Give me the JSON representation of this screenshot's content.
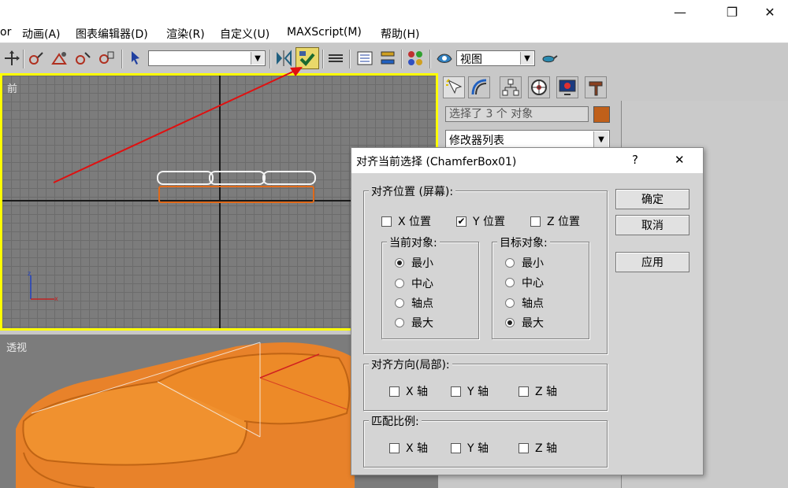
{
  "window": {
    "minimize_glyph": "—",
    "restore_glyph": "❐",
    "close_glyph": "✕"
  },
  "menu": {
    "items": [
      {
        "label": "or"
      },
      {
        "label": "动画(A)"
      },
      {
        "label": "图表编辑器(D)"
      },
      {
        "label": "渲染(R)"
      },
      {
        "label": "自定义(U)"
      },
      {
        "label": "MAXScript(M)"
      },
      {
        "label": "帮助(H)"
      }
    ]
  },
  "toolbar": {
    "selection_set_value": "",
    "view_combo_value": "视图",
    "icons": [
      "move-icon",
      "link-icon",
      "unlink-icon",
      "bind-icon",
      "select-icon",
      "mirror-icon",
      "align-icon",
      "layers-icon",
      "curve-editor-icon",
      "schematic-icon",
      "material-editor-icon",
      "render-setup-icon",
      "render-icon"
    ]
  },
  "viewports": {
    "front_label": "前",
    "persp_label": "透视",
    "active_border_color": "#ffff00",
    "object_color": "#e8822a"
  },
  "command_panel": {
    "tabs": [
      "create-icon",
      "modify-icon",
      "hierarchy-icon",
      "motion-icon",
      "display-icon",
      "utilities-icon"
    ],
    "selection_text": "选择了 3 个 对象",
    "swatch_color": "#c0601a",
    "modifier_list": "修改器列表"
  },
  "dialog": {
    "title": "对齐当前选择 (ChamferBox01)",
    "help_glyph": "?",
    "close_glyph": "✕",
    "align_position": {
      "title": "对齐位置 (屏幕):",
      "x": {
        "label": "X 位置",
        "checked": false
      },
      "y": {
        "label": "Y 位置",
        "checked": true
      },
      "z": {
        "label": "Z 位置",
        "checked": false
      }
    },
    "current_object": {
      "title": "当前对象:",
      "options": [
        "最小",
        "中心",
        "轴点",
        "最大"
      ],
      "selected": "最小"
    },
    "target_object": {
      "title": "目标对象:",
      "options": [
        "最小",
        "中心",
        "轴点",
        "最大"
      ],
      "selected": "最大"
    },
    "align_orientation": {
      "title": "对齐方向(局部):",
      "x": "X 轴",
      "y": "Y 轴",
      "z": "Z 轴"
    },
    "match_scale": {
      "title": "匹配比例:",
      "x": "X 轴",
      "y": "Y 轴",
      "z": "Z 轴"
    },
    "buttons": {
      "ok": "确定",
      "cancel": "取消",
      "apply": "应用"
    }
  }
}
